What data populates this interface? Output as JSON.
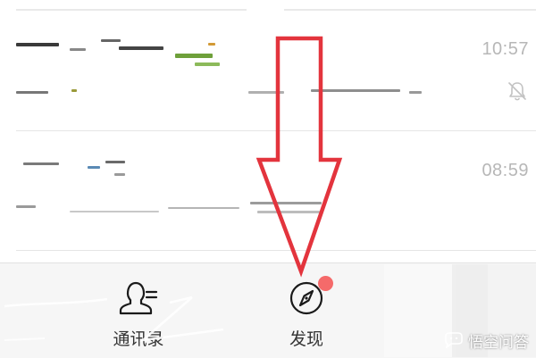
{
  "chat_list": {
    "items": [
      {
        "time": "10:57",
        "muted": true
      },
      {
        "time": "08:59",
        "muted": false
      }
    ]
  },
  "tab_bar": {
    "tabs": [
      {
        "label": "通讯录",
        "icon": "contacts-icon"
      },
      {
        "label": "发现",
        "icon": "compass-icon",
        "badge": true
      }
    ]
  },
  "watermark": {
    "text": "悟空问答"
  },
  "colors": {
    "annotation_arrow": "#e3343d",
    "badge": "#f56a6a",
    "time_text": "#b7b7b7",
    "tab_label": "#333333"
  }
}
